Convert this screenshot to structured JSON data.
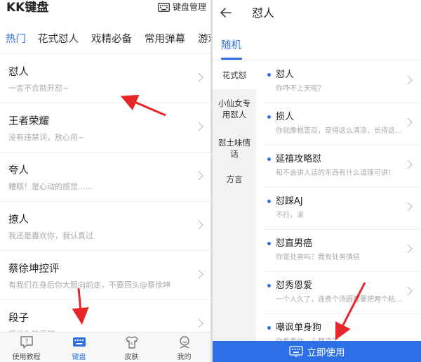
{
  "left": {
    "app_title": "KK键盘",
    "manage_label": "键盘管理",
    "tabs": [
      {
        "label": "热门",
        "active": true
      },
      {
        "label": "花式怼人",
        "active": false
      },
      {
        "label": "戏精必备",
        "active": false
      },
      {
        "label": "常用弹幕",
        "active": false
      },
      {
        "label": "游戏",
        "active": false
      }
    ],
    "items": [
      {
        "title": "怼人",
        "subtitle": "一言不合就开怼~"
      },
      {
        "title": "王者荣耀",
        "subtitle": "没有违禁词，放心用~"
      },
      {
        "title": "夸人",
        "subtitle": "糟糕！是心动的感觉......"
      },
      {
        "title": "撩人",
        "subtitle": "我还是喜欢你，我认真过"
      },
      {
        "title": "蔡徐坤控评",
        "subtitle": "有我们在身后你大胆向前走，不要回头@蔡徐坤"
      },
      {
        "title": "段子",
        "subtitle": "话说你的手脚"
      }
    ],
    "nav": [
      {
        "label": "使用教程",
        "icon": "question-bubble-icon",
        "active": false
      },
      {
        "label": "键盘",
        "icon": "keyboard-icon",
        "active": true
      },
      {
        "label": "皮肤",
        "icon": "shirt-icon",
        "active": false
      },
      {
        "label": "我的",
        "icon": "profile-icon",
        "active": false
      }
    ]
  },
  "right": {
    "title": "怼人",
    "tab_label": "随机",
    "sidebar": [
      {
        "label": "花式怼",
        "active": true
      },
      {
        "label": "小仙女专用怼人",
        "active": false
      },
      {
        "label": "怼土味情话",
        "active": false
      },
      {
        "label": "方言",
        "active": false
      }
    ],
    "items": [
      {
        "title": "怼人",
        "subtitle": "你咋不上天呢？"
      },
      {
        "title": "损人",
        "subtitle": "你就像根苦瓜，穿得这么清凉，长得这..."
      },
      {
        "title": "延禧攻略怼",
        "subtitle": "和不会讲人话的东西有什么道理可讲！"
      },
      {
        "title": "怼踩AJ",
        "subtitle": "不行，滚"
      },
      {
        "title": "怼直男癌",
        "subtitle": "你是处男吗？我有处男情结"
      },
      {
        "title": "怼秀恩爱",
        "subtitle": "一个人久了，连煮个汤圆都要把两个粘..."
      },
      {
        "title": "嘲讽单身狗",
        "subtitle": "你看看你，心都凉了"
      }
    ],
    "use_button": "立即使用"
  },
  "colors": {
    "accent": "#2f6fe0",
    "button_blue": "#2d6fe6",
    "annotation_red": "#e8262a"
  }
}
